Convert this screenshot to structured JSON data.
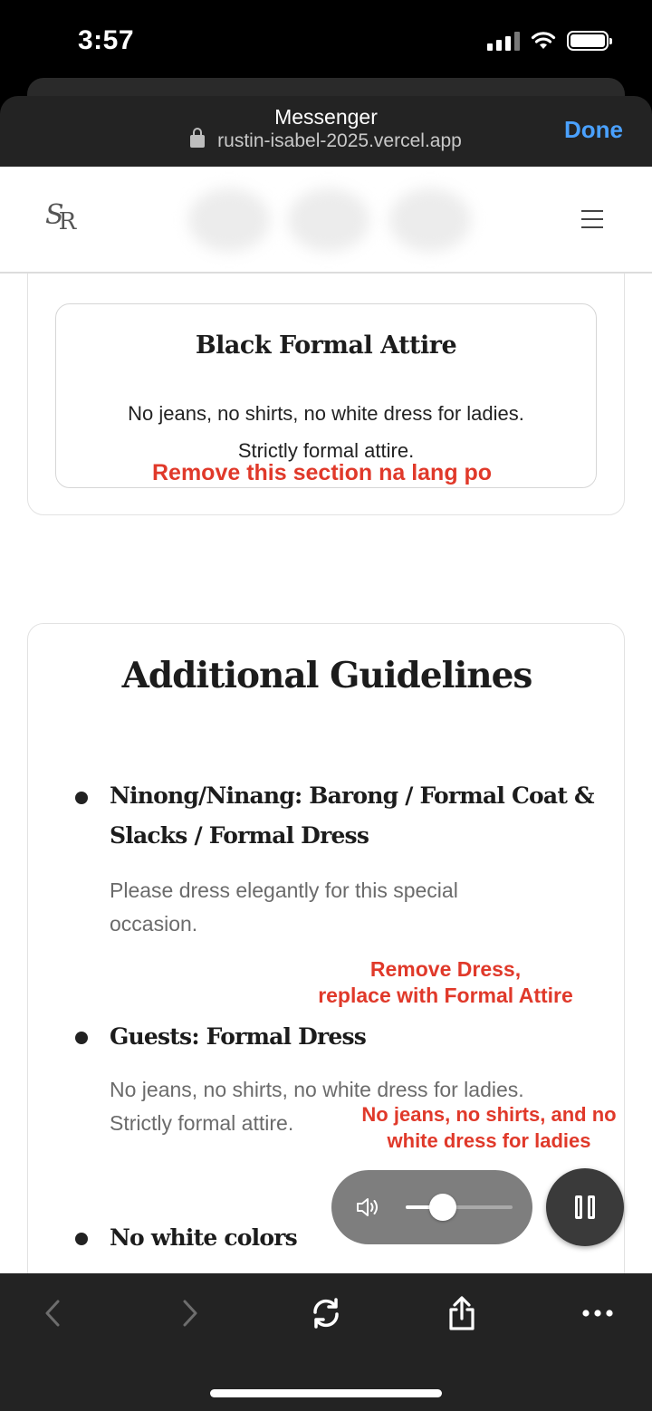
{
  "status_bar": {
    "time": "3:57"
  },
  "browser": {
    "title": "Messenger",
    "url": "rustin-isabel-2025.vercel.app",
    "done_label": "Done"
  },
  "site": {
    "logo_text": "&R"
  },
  "attire_section": {
    "title": "Black Formal Attire",
    "desc_line1": "No jeans, no shirts, no white dress for ladies.",
    "desc_line2": "Strictly formal attire.",
    "annotation": "Remove this section na lang po"
  },
  "guidelines": {
    "title": "Additional Guidelines",
    "items": [
      {
        "head_line1": "Ninong/Ninang: Barong / Formal Coat &",
        "head_line2": "Slacks / Formal Dress",
        "desc_line1": "Please dress elegantly for this special",
        "desc_line2": "occasion."
      },
      {
        "head_line1": "Guests: Formal Dress",
        "desc_line1": "No jeans, no shirts, no white dress for ladies.",
        "desc_line2": "Strictly formal attire."
      },
      {
        "head_line1": "No white colors"
      }
    ],
    "annotation_1_line1": "Remove Dress,",
    "annotation_1_line2": "replace with Formal Attire",
    "annotation_2_line1": "No jeans, no shirts, and no",
    "annotation_2_line2": "white dress for ladies"
  },
  "player": {
    "volume": 0.35
  },
  "toolbar": {
    "icons": [
      "back-icon",
      "forward-icon",
      "reload-icon",
      "share-icon",
      "more-icon"
    ]
  },
  "colors": {
    "annotation": "#e0392a",
    "done_link": "#4aa1ff"
  }
}
